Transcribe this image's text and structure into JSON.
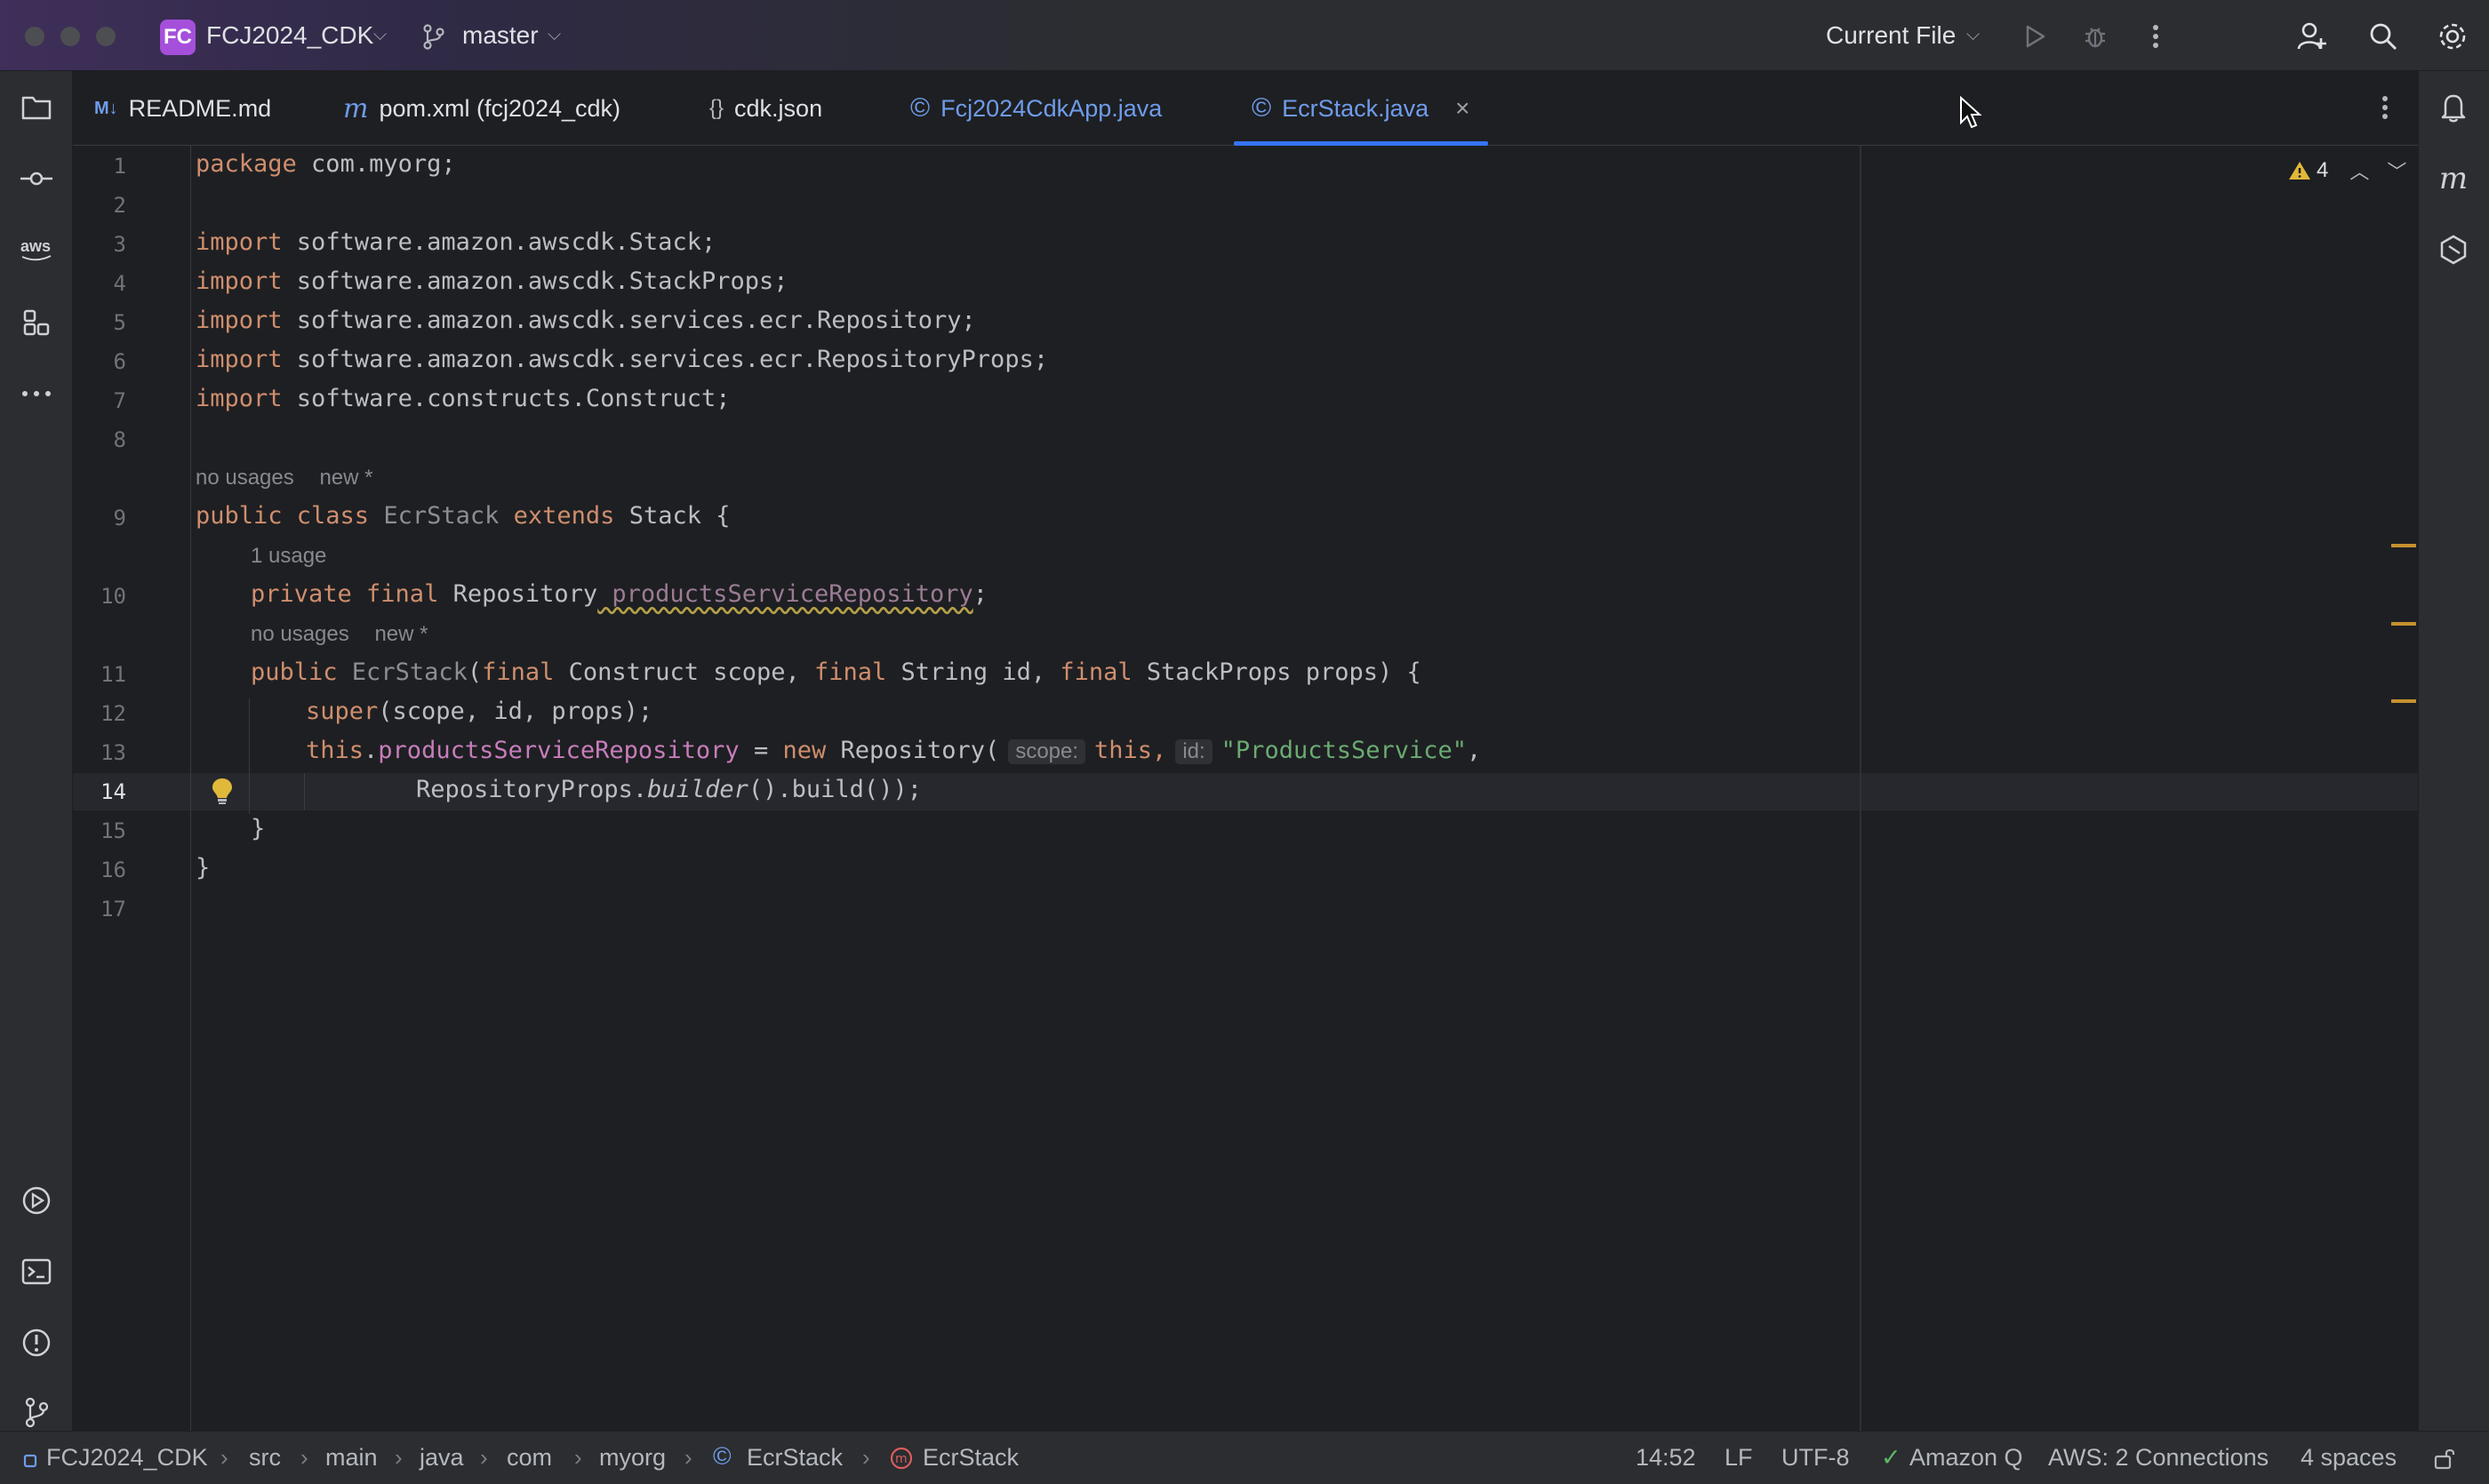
{
  "titlebar": {
    "project_badge": "FC",
    "project_name": "FCJ2024_CDK",
    "branch": "master",
    "run_config": "Current File",
    "icons": [
      "run-icon",
      "debug-icon",
      "more-icon",
      "add-user-icon",
      "search-icon",
      "settings-icon"
    ]
  },
  "tabs": [
    {
      "label": "README.md",
      "icon": "M↓",
      "icon_color": "#6f9ceb"
    },
    {
      "label": "pom.xml (fcj2024_cdk)",
      "icon": "m",
      "icon_color": "#6f9ceb"
    },
    {
      "label": "cdk.json",
      "icon": "{}",
      "icon_color": "#b4b8bf"
    },
    {
      "label": "Fcj2024CdkApp.java",
      "icon": "©",
      "icon_color": "#6f9ceb"
    },
    {
      "label": "EcrStack.java",
      "icon": "©",
      "icon_color": "#6f9ceb",
      "active": true
    }
  ],
  "editor": {
    "line_numbers": [
      "1",
      "2",
      "3",
      "4",
      "5",
      "6",
      "7",
      "8",
      "9",
      "10",
      "11",
      "12",
      "13",
      "14",
      "15",
      "16",
      "17"
    ],
    "lens_no_usages_1": "no usages",
    "lens_new_1": "new *",
    "lens_usage": "1 usage",
    "lens_no_usages_2": "no usages",
    "lens_new_2": "new *",
    "hint_scope": "scope:",
    "hint_id": "id:",
    "warning_count": "4"
  },
  "status": {
    "breadcrumb": [
      "FCJ2024_CDK",
      "src",
      "main",
      "java",
      "com",
      "myorg",
      "EcrStack",
      "EcrStack"
    ],
    "position": "14:52",
    "line_sep": "LF",
    "encoding": "UTF-8",
    "amazon_q": "Amazon Q",
    "aws": "AWS: 2 Connections",
    "indent": "4 spaces"
  },
  "colors": {
    "accent": "#3574f0",
    "keyword": "#cf8e6d",
    "string": "#6aab73",
    "field": "#c77dbb",
    "warning": "#c5912e"
  }
}
